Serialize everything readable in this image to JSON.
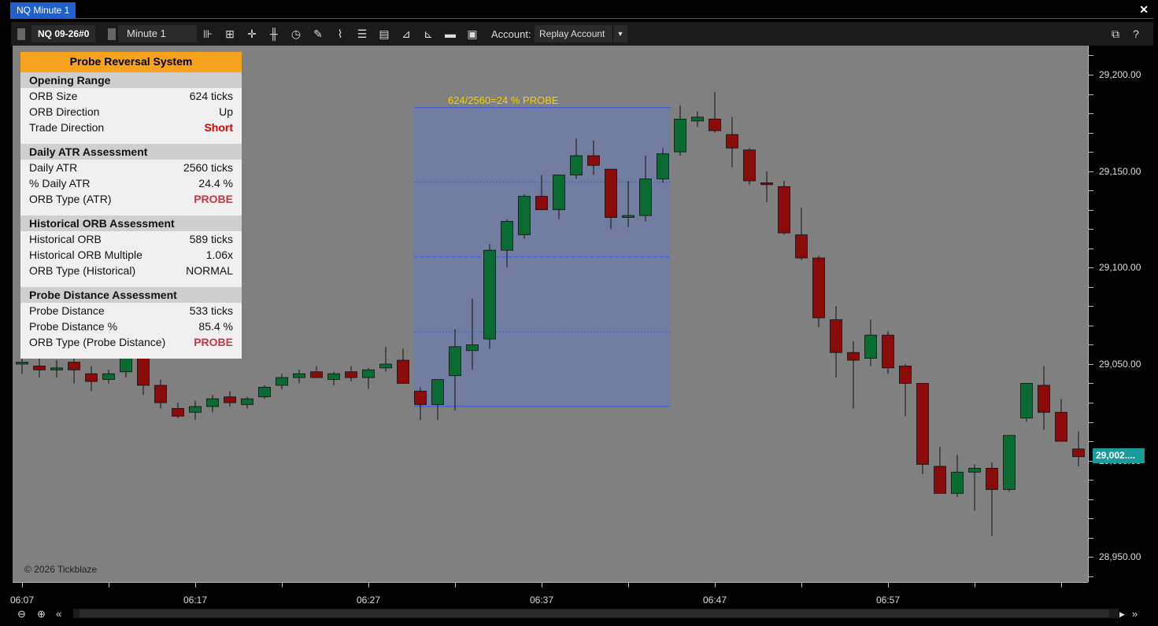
{
  "window": {
    "title": "NQ Minute 1",
    "close_icon": "close-icon"
  },
  "toolbar": {
    "instrument": "NQ 09-26#0",
    "period": "Minute 1",
    "account_label": "Account:",
    "account_value": "Replay Account",
    "icons": [
      "bar-type-icon",
      "indicators-icon",
      "crosshair-icon",
      "candlestick-icon",
      "clock-icon",
      "draw-pencil-icon",
      "line-tool-icon",
      "list-icon",
      "report-icon",
      "trend-line-icon",
      "axis-tool-icon",
      "folder-icon",
      "save-icon",
      "copy-icon",
      "help-icon"
    ]
  },
  "panel": {
    "title": "Probe Reversal System",
    "sections": [
      {
        "header": "Opening Range",
        "rows": [
          {
            "label": "ORB Size",
            "value": "624 ticks"
          },
          {
            "label": "ORB Direction",
            "value": "Up"
          },
          {
            "label": "Trade Direction",
            "value": "Short",
            "style": "short"
          }
        ]
      },
      {
        "header": "Daily ATR Assessment",
        "rows": [
          {
            "label": "Daily ATR",
            "value": "2560 ticks"
          },
          {
            "label": "% Daily ATR",
            "value": "24.4 %"
          },
          {
            "label": "ORB Type (ATR)",
            "value": "PROBE",
            "style": "probe"
          }
        ]
      },
      {
        "header": "Historical ORB Assessment",
        "rows": [
          {
            "label": "Historical ORB",
            "value": "589 ticks"
          },
          {
            "label": "Historical ORB Multiple",
            "value": "1.06x"
          },
          {
            "label": "ORB Type (Historical)",
            "value": "NORMAL"
          }
        ]
      },
      {
        "header": "Probe Distance Assessment",
        "rows": [
          {
            "label": "Probe Distance",
            "value": "533 ticks"
          },
          {
            "label": "Probe Distance %",
            "value": "85.4 %"
          },
          {
            "label": "ORB Type (Probe Distance)",
            "value": "PROBE",
            "style": "probe"
          }
        ]
      }
    ]
  },
  "chart": {
    "probe_label": "624/2560=24 % PROBE",
    "copyright": "© 2026 Tickblaze",
    "current_price_tag": "29,002....",
    "y_tick_labels": [
      "29,200.00",
      "29,150.00",
      "29,100.00",
      "29,050.00",
      "29,000.00",
      "28,950.00"
    ],
    "x_tick_labels": [
      "06:07",
      "06:17",
      "06:27",
      "06:37",
      "06:47",
      "06:57"
    ],
    "colors": {
      "up": "#0a6b32",
      "down": "#8b0a0a",
      "box": "#6f7ea8",
      "box_line": "#3355ee",
      "label": "#f5d200"
    }
  },
  "chart_data": {
    "type": "candlestick",
    "ylim": [
      28930,
      29220
    ],
    "orb_box": {
      "high": 29183,
      "low": 29028,
      "start": "06:30",
      "end": "06:44"
    },
    "candles": [
      {
        "t": "06:07",
        "o": 29050,
        "h": 29055,
        "l": 29045,
        "c": 29051
      },
      {
        "t": "06:08",
        "o": 29049,
        "h": 29054,
        "l": 29043,
        "c": 29047
      },
      {
        "t": "06:09",
        "o": 29047,
        "h": 29052,
        "l": 29043,
        "c": 29048
      },
      {
        "t": "06:10",
        "o": 29051,
        "h": 29057,
        "l": 29040,
        "c": 29047
      },
      {
        "t": "06:11",
        "o": 29045,
        "h": 29049,
        "l": 29036,
        "c": 29041
      },
      {
        "t": "06:12",
        "o": 29042,
        "h": 29047,
        "l": 29040,
        "c": 29045
      },
      {
        "t": "06:13",
        "o": 29046,
        "h": 29062,
        "l": 29043,
        "c": 29054
      },
      {
        "t": "06:14",
        "o": 29054,
        "h": 29058,
        "l": 29034,
        "c": 29039
      },
      {
        "t": "06:15",
        "o": 29039,
        "h": 29042,
        "l": 29027,
        "c": 29030
      },
      {
        "t": "06:16",
        "o": 29027,
        "h": 29030,
        "l": 29022,
        "c": 29023
      },
      {
        "t": "06:17",
        "o": 29025,
        "h": 29031,
        "l": 29021,
        "c": 29028
      },
      {
        "t": "06:18",
        "o": 29028,
        "h": 29034,
        "l": 29025,
        "c": 29032
      },
      {
        "t": "06:19",
        "o": 29033,
        "h": 29036,
        "l": 29028,
        "c": 29030
      },
      {
        "t": "06:20",
        "o": 29029,
        "h": 29033,
        "l": 29027,
        "c": 29032
      },
      {
        "t": "06:21",
        "o": 29033,
        "h": 29039,
        "l": 29032,
        "c": 29038
      },
      {
        "t": "06:22",
        "o": 29039,
        "h": 29045,
        "l": 29037,
        "c": 29043
      },
      {
        "t": "06:23",
        "o": 29043,
        "h": 29047,
        "l": 29040,
        "c": 29045
      },
      {
        "t": "06:24",
        "o": 29046,
        "h": 29049,
        "l": 29043,
        "c": 29043
      },
      {
        "t": "06:25",
        "o": 29042,
        "h": 29046,
        "l": 29039,
        "c": 29045
      },
      {
        "t": "06:26",
        "o": 29046,
        "h": 29049,
        "l": 29041,
        "c": 29043
      },
      {
        "t": "06:27",
        "o": 29043,
        "h": 29048,
        "l": 29037,
        "c": 29047
      },
      {
        "t": "06:28",
        "o": 29048,
        "h": 29059,
        "l": 29046,
        "c": 29050
      },
      {
        "t": "06:29",
        "o": 29052,
        "h": 29058,
        "l": 29040,
        "c": 29040
      },
      {
        "t": "06:30",
        "o": 29036,
        "h": 29038,
        "l": 29021,
        "c": 29029
      },
      {
        "t": "06:31",
        "o": 29029,
        "h": 29040,
        "l": 29021,
        "c": 29042
      },
      {
        "t": "06:32",
        "o": 29044,
        "h": 29068,
        "l": 29026,
        "c": 29059
      },
      {
        "t": "06:33",
        "o": 29057,
        "h": 29084,
        "l": 29047,
        "c": 29060
      },
      {
        "t": "06:34",
        "o": 29063,
        "h": 29112,
        "l": 29058,
        "c": 29109
      },
      {
        "t": "06:35",
        "o": 29109,
        "h": 29125,
        "l": 29100,
        "c": 29124
      },
      {
        "t": "06:36",
        "o": 29117,
        "h": 29138,
        "l": 29115,
        "c": 29137
      },
      {
        "t": "06:37",
        "o": 29137,
        "h": 29148,
        "l": 29130,
        "c": 29130
      },
      {
        "t": "06:38",
        "o": 29130,
        "h": 29148,
        "l": 29125,
        "c": 29148
      },
      {
        "t": "06:39",
        "o": 29148,
        "h": 29167,
        "l": 29146,
        "c": 29158
      },
      {
        "t": "06:40",
        "o": 29158,
        "h": 29166,
        "l": 29148,
        "c": 29153
      },
      {
        "t": "06:41",
        "o": 29151,
        "h": 29150,
        "l": 29120,
        "c": 29126
      },
      {
        "t": "06:42",
        "o": 29126,
        "h": 29145,
        "l": 29121,
        "c": 29127
      },
      {
        "t": "06:43",
        "o": 29127,
        "h": 29158,
        "l": 29124,
        "c": 29146
      },
      {
        "t": "06:44",
        "o": 29146,
        "h": 29162,
        "l": 29144,
        "c": 29159
      },
      {
        "t": "06:45",
        "o": 29160,
        "h": 29184,
        "l": 29158,
        "c": 29177
      },
      {
        "t": "06:46",
        "o": 29176,
        "h": 29181,
        "l": 29173,
        "c": 29178
      },
      {
        "t": "06:47",
        "o": 29177,
        "h": 29191,
        "l": 29170,
        "c": 29171
      },
      {
        "t": "06:48",
        "o": 29169,
        "h": 29178,
        "l": 29152,
        "c": 29162
      },
      {
        "t": "06:49",
        "o": 29161,
        "h": 29162,
        "l": 29143,
        "c": 29145
      },
      {
        "t": "06:50",
        "o": 29144,
        "h": 29150,
        "l": 29134,
        "c": 29143
      },
      {
        "t": "06:51",
        "o": 29142,
        "h": 29145,
        "l": 29117,
        "c": 29118
      },
      {
        "t": "06:52",
        "o": 29117,
        "h": 29131,
        "l": 29104,
        "c": 29105
      },
      {
        "t": "06:53",
        "o": 29105,
        "h": 29106,
        "l": 29069,
        "c": 29074
      },
      {
        "t": "06:54",
        "o": 29073,
        "h": 29080,
        "l": 29043,
        "c": 29056
      },
      {
        "t": "06:55",
        "o": 29056,
        "h": 29062,
        "l": 29027,
        "c": 29052
      },
      {
        "t": "06:56",
        "o": 29053,
        "h": 29073,
        "l": 29049,
        "c": 29065
      },
      {
        "t": "06:57",
        "o": 29065,
        "h": 29067,
        "l": 29045,
        "c": 29048
      },
      {
        "t": "06:58",
        "o": 29049,
        "h": 29050,
        "l": 29023,
        "c": 29040
      },
      {
        "t": "06:59",
        "o": 29040,
        "h": 29040,
        "l": 28993,
        "c": 28998
      },
      {
        "t": "07:00",
        "o": 28997,
        "h": 29007,
        "l": 28983,
        "c": 28983
      },
      {
        "t": "07:01",
        "o": 28983,
        "h": 29003,
        "l": 28981,
        "c": 28994
      },
      {
        "t": "07:02",
        "o": 28994,
        "h": 28998,
        "l": 28974,
        "c": 28996
      },
      {
        "t": "07:03",
        "o": 28996,
        "h": 28999,
        "l": 28961,
        "c": 28985
      },
      {
        "t": "07:04",
        "o": 28985,
        "h": 29013,
        "l": 28984,
        "c": 29013
      },
      {
        "t": "07:05",
        "o": 29022,
        "h": 29039,
        "l": 29020,
        "c": 29040
      },
      {
        "t": "07:06",
        "o": 29039,
        "h": 29049,
        "l": 29016,
        "c": 29025
      },
      {
        "t": "07:07",
        "o": 29025,
        "h": 29032,
        "l": 29011,
        "c": 29010
      },
      {
        "t": "07:08",
        "o": 29006,
        "h": 29015,
        "l": 28997,
        "c": 29002
      }
    ]
  }
}
